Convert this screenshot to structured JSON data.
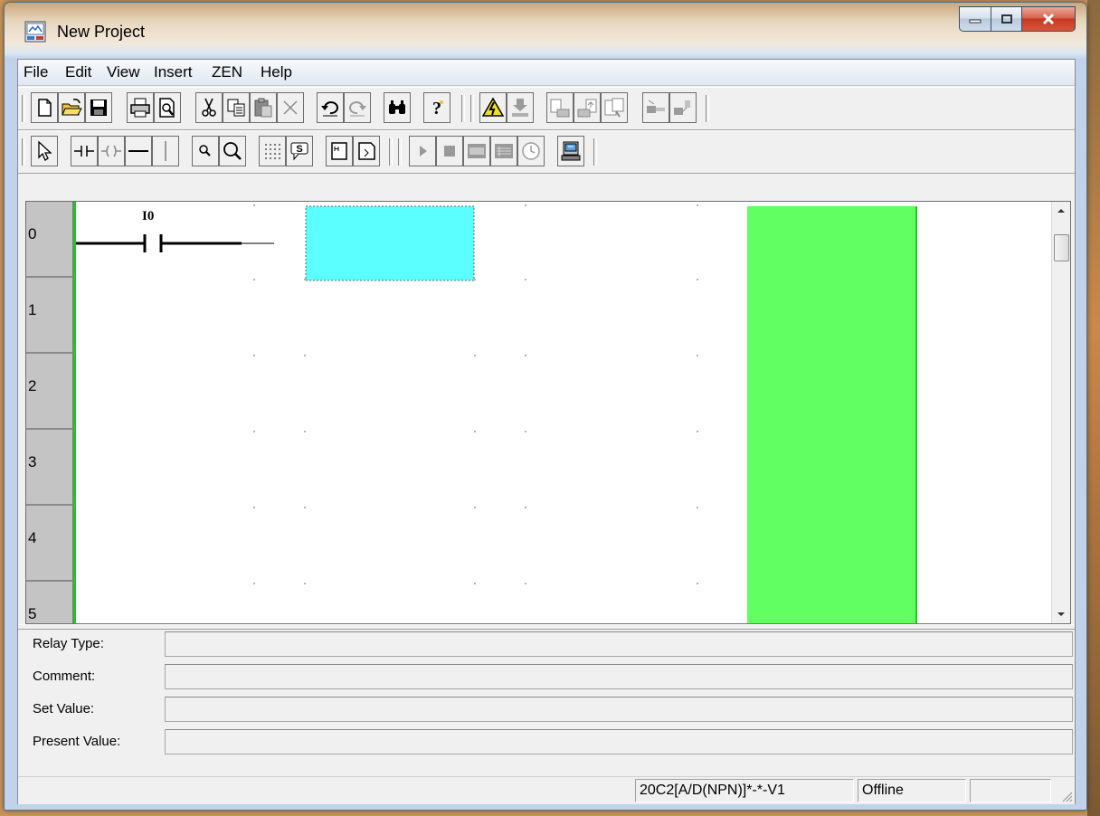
{
  "window": {
    "title": "New Project"
  },
  "menu": [
    "File",
    "Edit",
    "View",
    "Insert",
    "ZEN",
    "Help"
  ],
  "toolbar1": [
    "new-icon",
    "open-icon",
    "save-icon",
    "print-icon",
    "print-preview-icon",
    "cut-icon",
    "copy-icon",
    "paste-icon",
    "delete-icon",
    "undo-icon",
    "redo-icon",
    "find-icon",
    "help-icon",
    "warning-icon",
    "transfer-icon",
    "upload-icon",
    "download-icon",
    "compare-icon",
    "connect-icon",
    "disconnect-icon"
  ],
  "toolbar2": [
    "pointer-icon",
    "contact-icon",
    "coil-icon",
    "horizontal-line-icon",
    "vertical-line-icon",
    "zoom-out-icon",
    "zoom-in-icon",
    "grid-icon",
    "comment-icon",
    "program-check-icon",
    "memory-icon",
    "run-icon",
    "stop-icon",
    "monitor-icon",
    "list-icon",
    "timer-icon",
    "simulation-icon"
  ],
  "ladder": {
    "rows": [
      "0",
      "1",
      "2",
      "3",
      "4",
      "5"
    ],
    "contact_label": "I0",
    "colors": {
      "cursor": "#5cffff",
      "output_column": "#62ff62",
      "power_rail": "#22c422"
    }
  },
  "properties": [
    {
      "label": "Relay Type:",
      "value": ""
    },
    {
      "label": "Comment:",
      "value": ""
    },
    {
      "label": "Set Value:",
      "value": ""
    },
    {
      "label": "Present Value:",
      "value": ""
    }
  ],
  "status": {
    "model": "20C2[A/D(NPN)]*-*-V1",
    "connection": "Offline",
    "extra": ""
  }
}
